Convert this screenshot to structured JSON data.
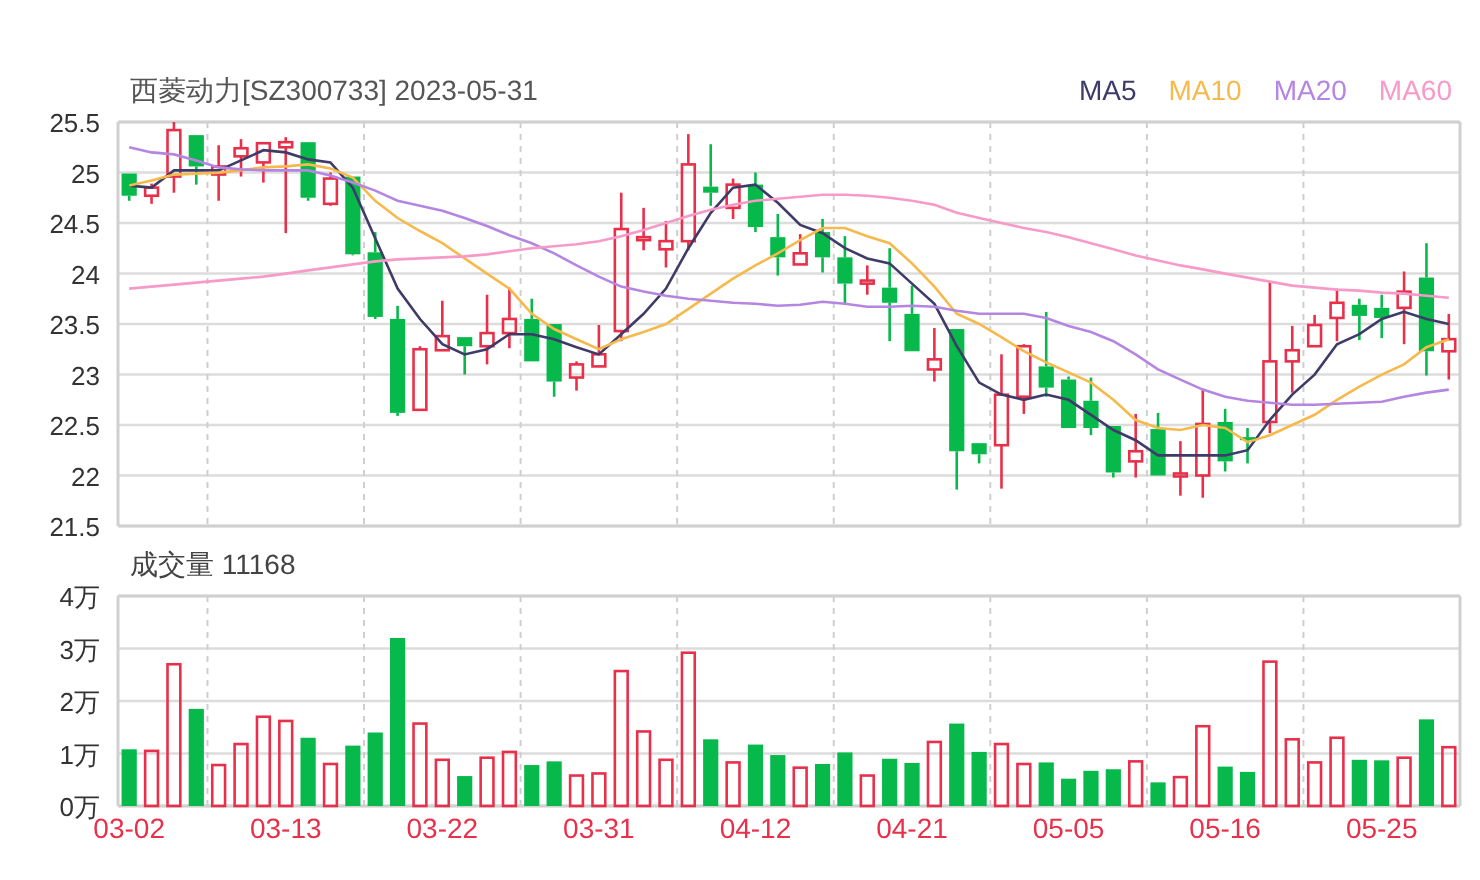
{
  "header": {
    "title": "西菱动力[SZ300733] 2023-05-31"
  },
  "price_chart": {
    "chart_data": {
      "type": "candlestick",
      "grid": true,
      "ylim": [
        21.5,
        25.5
      ],
      "yticks": [
        21.5,
        22,
        22.5,
        23,
        23.5,
        24,
        24.5,
        25,
        25.5
      ],
      "series": [
        {
          "name": "MA5",
          "type": "line",
          "color": "#3e3b68",
          "values": [
            24.87,
            24.85,
            25.02,
            25.02,
            25.02,
            25.12,
            25.22,
            25.2,
            25.13,
            25.1,
            24.85,
            24.35,
            23.85,
            23.55,
            23.3,
            23.2,
            23.25,
            23.4,
            23.4,
            23.35,
            23.27,
            23.2,
            23.4,
            23.6,
            23.85,
            24.25,
            24.6,
            24.85,
            24.88,
            24.7,
            24.48,
            24.4,
            24.25,
            24.15,
            24.1,
            23.9,
            23.7,
            23.28,
            22.92,
            22.8,
            22.75,
            22.8,
            22.75,
            22.6,
            22.45,
            22.35,
            22.2,
            22.2,
            22.2,
            22.2,
            22.25,
            22.55,
            22.8,
            23.0,
            23.3,
            23.4,
            23.55,
            23.62,
            23.55,
            23.5
          ]
        },
        {
          "name": "MA10",
          "type": "line",
          "color": "#f6b94c",
          "values": [
            24.87,
            24.92,
            24.98,
            24.99,
            25.0,
            25.02,
            25.05,
            25.06,
            25.08,
            25.04,
            24.95,
            24.72,
            24.55,
            24.42,
            24.3,
            24.15,
            24.0,
            23.85,
            23.6,
            23.45,
            23.35,
            23.25,
            23.35,
            23.42,
            23.5,
            23.65,
            23.8,
            23.95,
            24.08,
            24.2,
            24.33,
            24.45,
            24.45,
            24.37,
            24.3,
            24.1,
            23.87,
            23.6,
            23.5,
            23.37,
            23.23,
            23.12,
            23.02,
            22.92,
            22.75,
            22.55,
            22.47,
            22.45,
            22.5,
            22.47,
            22.33,
            22.4,
            22.5,
            22.6,
            22.75,
            22.88,
            23.0,
            23.1,
            23.27,
            23.35
          ]
        },
        {
          "name": "MA20",
          "type": "line",
          "color": "#b486e2",
          "values": [
            25.25,
            25.2,
            25.18,
            25.12,
            25.05,
            25.03,
            25.02,
            25.02,
            25.02,
            24.97,
            24.9,
            24.82,
            24.72,
            24.67,
            24.62,
            24.55,
            24.47,
            24.38,
            24.3,
            24.2,
            24.08,
            23.97,
            23.87,
            23.82,
            23.78,
            23.75,
            23.73,
            23.71,
            23.7,
            23.68,
            23.69,
            23.72,
            23.7,
            23.67,
            23.67,
            23.68,
            23.67,
            23.63,
            23.6,
            23.6,
            23.6,
            23.56,
            23.48,
            23.42,
            23.33,
            23.2,
            23.05,
            22.95,
            22.85,
            22.78,
            22.74,
            22.72,
            22.7,
            22.7,
            22.71,
            22.72,
            22.73,
            22.78,
            22.82,
            22.85
          ]
        },
        {
          "name": "MA60",
          "type": "line",
          "color": "#f79ac8",
          "values": [
            23.85,
            23.87,
            23.89,
            23.91,
            23.93,
            23.95,
            23.97,
            24.0,
            24.03,
            24.06,
            24.09,
            24.12,
            24.14,
            24.15,
            24.16,
            24.17,
            24.19,
            24.22,
            24.25,
            24.27,
            24.29,
            24.32,
            24.37,
            24.43,
            24.5,
            24.57,
            24.63,
            24.68,
            24.72,
            24.74,
            24.76,
            24.78,
            24.78,
            24.77,
            24.75,
            24.72,
            24.68,
            24.6,
            24.55,
            24.5,
            24.45,
            24.41,
            24.36,
            24.3,
            24.24,
            24.18,
            24.13,
            24.08,
            24.04,
            24.0,
            23.96,
            23.92,
            23.88,
            23.86,
            23.84,
            23.83,
            23.81,
            23.8,
            23.78,
            23.76
          ]
        }
      ],
      "ohlc": [
        [
          24.99,
          24.99,
          24.72,
          24.77
        ],
        [
          24.77,
          24.89,
          24.69,
          24.85
        ],
        [
          24.96,
          25.5,
          24.8,
          25.42
        ],
        [
          25.37,
          25.37,
          24.88,
          25.06
        ],
        [
          24.98,
          25.27,
          24.72,
          25.06
        ],
        [
          25.16,
          25.33,
          24.96,
          25.24
        ],
        [
          25.1,
          25.29,
          24.9,
          25.29
        ],
        [
          25.25,
          25.35,
          24.4,
          25.3
        ],
        [
          25.3,
          25.3,
          24.72,
          24.75
        ],
        [
          24.69,
          25.0,
          24.67,
          24.94
        ],
        [
          24.96,
          24.96,
          24.18,
          24.19
        ],
        [
          24.21,
          24.41,
          23.55,
          23.57
        ],
        [
          23.55,
          23.68,
          22.59,
          22.62
        ],
        [
          22.65,
          23.28,
          22.65,
          23.25
        ],
        [
          23.24,
          23.73,
          23.24,
          23.38
        ],
        [
          23.37,
          23.37,
          23.0,
          23.28
        ],
        [
          23.28,
          23.79,
          23.1,
          23.41
        ],
        [
          23.41,
          23.86,
          23.26,
          23.55
        ],
        [
          23.55,
          23.75,
          23.13,
          23.13
        ],
        [
          23.5,
          23.5,
          22.78,
          22.93
        ],
        [
          22.97,
          23.13,
          22.84,
          23.1
        ],
        [
          23.08,
          23.49,
          23.08,
          23.2
        ],
        [
          23.43,
          24.8,
          23.33,
          24.44
        ],
        [
          24.33,
          24.65,
          24.23,
          24.36
        ],
        [
          24.24,
          24.52,
          24.06,
          24.32
        ],
        [
          24.32,
          25.38,
          24.23,
          25.08
        ],
        [
          24.86,
          25.28,
          24.67,
          24.8
        ],
        [
          24.65,
          24.94,
          24.54,
          24.88
        ],
        [
          24.88,
          25.0,
          24.41,
          24.46
        ],
        [
          24.36,
          24.59,
          23.98,
          24.16
        ],
        [
          24.09,
          24.39,
          24.09,
          24.2
        ],
        [
          24.41,
          24.54,
          24.01,
          24.16
        ],
        [
          24.16,
          24.37,
          23.69,
          23.9
        ],
        [
          23.9,
          24.08,
          23.79,
          23.93
        ],
        [
          23.86,
          24.25,
          23.33,
          23.71
        ],
        [
          23.6,
          23.88,
          23.23,
          23.23
        ],
        [
          23.05,
          23.46,
          22.93,
          23.15
        ],
        [
          23.45,
          23.45,
          21.86,
          22.24
        ],
        [
          22.32,
          22.32,
          22.12,
          22.21
        ],
        [
          22.3,
          23.2,
          21.87,
          22.8
        ],
        [
          22.78,
          23.3,
          22.61,
          23.28
        ],
        [
          23.08,
          23.62,
          22.78,
          22.87
        ],
        [
          22.95,
          22.98,
          22.47,
          22.47
        ],
        [
          22.74,
          22.97,
          22.4,
          22.47
        ],
        [
          22.49,
          22.49,
          21.98,
          22.03
        ],
        [
          22.14,
          22.61,
          21.98,
          22.24
        ],
        [
          22.46,
          22.62,
          22.0,
          22.0
        ],
        [
          22.0,
          22.34,
          21.8,
          22.02
        ],
        [
          22.0,
          22.86,
          21.78,
          22.51
        ],
        [
          22.53,
          22.66,
          22.04,
          22.14
        ],
        [
          22.38,
          22.47,
          22.12,
          22.36
        ],
        [
          22.53,
          23.92,
          22.42,
          23.13
        ],
        [
          23.13,
          23.48,
          22.82,
          23.24
        ],
        [
          23.28,
          23.59,
          23.28,
          23.49
        ],
        [
          23.56,
          23.85,
          23.33,
          23.71
        ],
        [
          23.69,
          23.75,
          23.34,
          23.58
        ],
        [
          23.66,
          23.79,
          23.36,
          23.56
        ],
        [
          23.66,
          24.02,
          23.3,
          23.82
        ],
        [
          23.96,
          24.3,
          22.99,
          23.23
        ],
        [
          23.23,
          23.6,
          22.95,
          23.35
        ]
      ]
    }
  },
  "volume_chart": {
    "title": "成交量 11168",
    "chart_data": {
      "type": "bar",
      "grid": true,
      "ylim": [
        0,
        4
      ],
      "yticks": [
        {
          "value": 0,
          "label": "0万"
        },
        {
          "value": 1,
          "label": "1万"
        },
        {
          "value": 2,
          "label": "2万"
        },
        {
          "value": 3,
          "label": "3万"
        },
        {
          "value": 4,
          "label": "4万"
        }
      ],
      "categories": [
        "03-02",
        null,
        null,
        null,
        null,
        null,
        null,
        "03-13",
        null,
        null,
        null,
        null,
        null,
        null,
        "03-22",
        null,
        null,
        null,
        null,
        null,
        null,
        "03-31",
        null,
        null,
        null,
        null,
        null,
        null,
        "04-12",
        null,
        null,
        null,
        null,
        null,
        null,
        "04-21",
        null,
        null,
        null,
        null,
        null,
        null,
        "05-05",
        null,
        null,
        null,
        null,
        null,
        null,
        "05-16",
        null,
        null,
        null,
        null,
        null,
        null,
        "05-25",
        null,
        null,
        null
      ],
      "values": [
        1.08,
        1.05,
        2.7,
        1.85,
        0.78,
        1.18,
        1.7,
        1.62,
        1.3,
        0.8,
        1.15,
        1.4,
        3.2,
        1.57,
        0.88,
        0.57,
        0.92,
        1.03,
        0.78,
        0.85,
        0.58,
        0.62,
        2.57,
        1.42,
        0.88,
        2.92,
        1.27,
        0.83,
        1.17,
        0.97,
        0.73,
        0.8,
        1.02,
        0.58,
        0.9,
        0.82,
        1.22,
        1.57,
        1.03,
        1.18,
        0.8,
        0.83,
        0.52,
        0.67,
        0.7,
        0.85,
        0.45,
        0.55,
        1.52,
        0.75,
        0.65,
        2.75,
        1.27,
        0.83,
        1.3,
        0.88,
        0.87,
        0.92,
        1.65,
        1.12
      ]
    }
  }
}
